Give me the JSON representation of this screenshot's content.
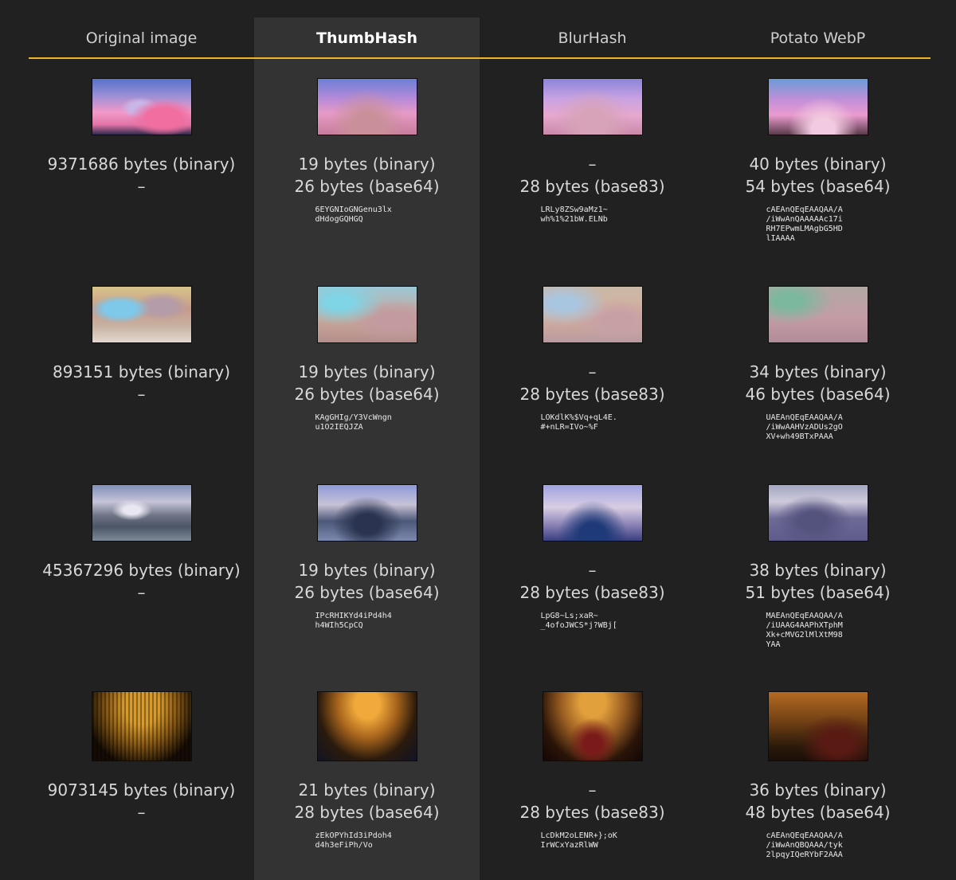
{
  "header": {
    "columns": [
      "Original image",
      "ThumbHash",
      "BlurHash",
      "Potato WebP"
    ],
    "active_column": "ThumbHash",
    "accent_color": "#f0b429"
  },
  "rows": [
    {
      "original": {
        "binary": "9371686 bytes (binary)",
        "text": "–"
      },
      "thumbhash": {
        "binary": "19 bytes (binary)",
        "text": "26 bytes (base64)",
        "code": "6EYGNIoGNGenu3lx\ndHdogGQHGQ"
      },
      "blurhash": {
        "binary": "–",
        "text": "28 bytes (base83)",
        "code": "LRLy8ZSw9aMz1~\nwh%1%21bW.ELNb"
      },
      "webp": {
        "binary": "40 bytes (binary)",
        "text": "54 bytes (base64)",
        "code": "cAEAnQEqEAAQAA/A\n/iWwAnQAAAAAc17i\nRH7EPwmLMAgbG5HD\nlIAAAA"
      }
    },
    {
      "original": {
        "binary": "893151 bytes (binary)",
        "text": "–"
      },
      "thumbhash": {
        "binary": "19 bytes (binary)",
        "text": "26 bytes (base64)",
        "code": "KAgGHIg/Y3VcWngn\nu1O2IEQJZA"
      },
      "blurhash": {
        "binary": "–",
        "text": "28 bytes (base83)",
        "code": "LOKdlK%$Vq+qL4E.\n#+nLR=IVo~%F"
      },
      "webp": {
        "binary": "34 bytes (binary)",
        "text": "46 bytes (base64)",
        "code": "UAEAnQEqEAAQAA/A\n/iWwAAHVzADUs2gO\nXV+wh49BTxPAAA"
      }
    },
    {
      "original": {
        "binary": "45367296 bytes (binary)",
        "text": "–"
      },
      "thumbhash": {
        "binary": "19 bytes (binary)",
        "text": "26 bytes (base64)",
        "code": "IPcRHIKYd4iPd4h4\nh4WIh5CpCQ"
      },
      "blurhash": {
        "binary": "–",
        "text": "28 bytes (base83)",
        "code": "LpG8~Ls;xaR~\n_4ofoJWCS*j?WBj["
      },
      "webp": {
        "binary": "38 bytes (binary)",
        "text": "51 bytes (base64)",
        "code": "MAEAnQEqEAAQAA/A\n/iUAAG4AAPhXTphM\nXk+cMVG2lMlXtM98\nYAA"
      }
    },
    {
      "original": {
        "binary": "9073145 bytes (binary)",
        "text": "–"
      },
      "thumbhash": {
        "binary": "21 bytes (binary)",
        "text": "28 bytes (base64)",
        "code": "zEkOPYhId3iPdoh4\nd4h3eFiPh/Vo"
      },
      "blurhash": {
        "binary": "–",
        "text": "28 bytes (base83)",
        "code": "LcDkM2oLENR+};oK\nIrWCxYazRlWW"
      },
      "webp": {
        "binary": "36 bytes (binary)",
        "text": "48 bytes (base64)",
        "code": "cAEAnQEqEAAQAA/A\n/iWwAnQBQAAA/tyk\n2lpqyIQeRYbF2AAA"
      }
    }
  ]
}
